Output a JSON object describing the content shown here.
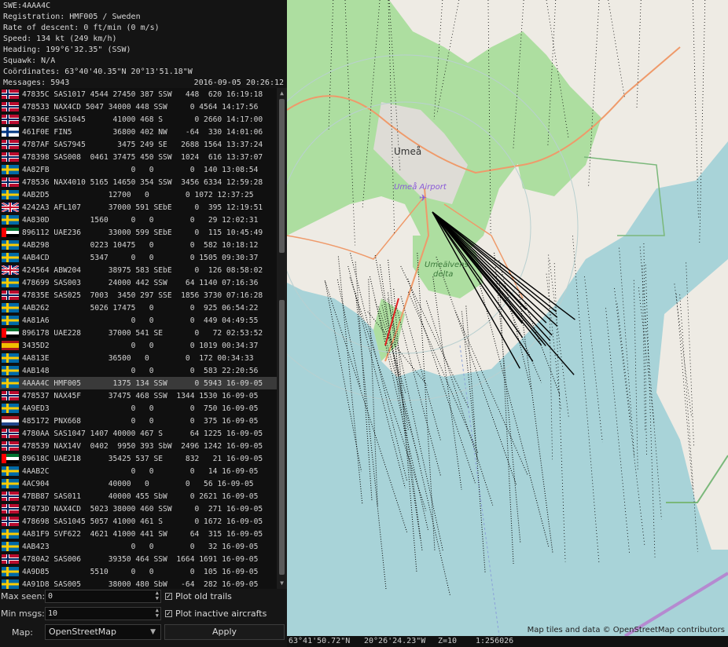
{
  "info": {
    "title": "SWE:4AAA4C",
    "registration": "Registration: HMF005 / Sweden",
    "descent": "Rate of descent: 0 ft/min (0 m/s)",
    "speed": "Speed: 134 kt (249 km/h)",
    "heading": "Heading: 199°6'32.35\" (SSW)",
    "squawk": "Squawk: N/A",
    "coordinates": "Coördinates: 63°40'40.35\"N 20°13'51.18\"W",
    "messages": "Messages: 5943",
    "timestamp": "2016-09-05 20:26:12"
  },
  "aircraft": [
    {
      "flag": "no",
      "text": "47835C SAS1017 4544 27450 387 SSW   448  620 16:19:18"
    },
    {
      "flag": "no",
      "text": "478533 NAX4CD 5047 34000 448 SSW     0 4564 14:17:56"
    },
    {
      "flag": "no",
      "text": "47836E SAS1045      41000 468 S       0 2660 14:17:00"
    },
    {
      "flag": "fi",
      "text": "461F0E FIN5         36800 402 NW    -64  330 14:01:06"
    },
    {
      "flag": "no",
      "text": "4787AF SAS7945       3475 249 SE   2688 1564 13:37:24"
    },
    {
      "flag": "no",
      "text": "478398 SAS008  0461 37475 450 SSW  1024  616 13:37:07"
    },
    {
      "flag": "se",
      "text": "4A82FB                  0   0        0  140 13:08:54"
    },
    {
      "flag": "no",
      "text": "478536 NAX4010 5165 14650 354 SSW  3456 6334 12:59:28"
    },
    {
      "flag": "se",
      "text": "4AB2D5             12700   0        0 1072 12:37:25"
    },
    {
      "flag": "gb",
      "text": "4242A3 AFL107      37000 591 SEbE     0  395 12:19:51"
    },
    {
      "flag": "se",
      "text": "4A830D         1560     0   0        0   29 12:02:31"
    },
    {
      "flag": "ae",
      "text": "896112 UAE236      33000 599 SEbE     0  115 10:45:49"
    },
    {
      "flag": "se",
      "text": "4AB298         0223 10475   0        0  582 10:18:12"
    },
    {
      "flag": "se",
      "text": "4AB4CD         5347     0   0        0 1505 09:30:37"
    },
    {
      "flag": "gb",
      "text": "424564 ABW204      38975 583 SEbE     0  126 08:58:02"
    },
    {
      "flag": "se",
      "text": "478699 SAS003      24000 442 SSW    64 1140 07:16:36"
    },
    {
      "flag": "no",
      "text": "47835E SAS025  7003  3450 297 SSE  1856 3730 07:16:28"
    },
    {
      "flag": "se",
      "text": "4AB262         5026 17475   0        0  925 06:54:22"
    },
    {
      "flag": "se",
      "text": "4A81A6                  0   0        0  449 04:49:55"
    },
    {
      "flag": "ae",
      "text": "896178 UAE228      37000 541 SE       0   72 02:53:52"
    },
    {
      "flag": "es",
      "text": "3435D2                  0   0        0 1019 00:34:37"
    },
    {
      "flag": "se",
      "text": "4A813E             36500   0        0  172 00:34:33"
    },
    {
      "flag": "se",
      "text": "4AB148                  0   0        0  583 22:20:56"
    },
    {
      "flag": "se",
      "text": "4AAA4C HMF005       1375 134 SSW      0 5943 16-09-05"
    },
    {
      "flag": "no",
      "text": "478537 NAX45F      37475 468 SSW  1344 1530 16-09-05"
    },
    {
      "flag": "se",
      "text": "4A9ED3                  0   0        0  750 16-09-05"
    },
    {
      "flag": "nl",
      "text": "485172 PNX668           0   0        0  375 16-09-05"
    },
    {
      "flag": "no",
      "text": "4780AA SAS1047 1407 40000 467 S      64 1225 16-09-05"
    },
    {
      "flag": "no",
      "text": "478539 NAX14V  0402  9950 393 SbW  2496 1242 16-09-05"
    },
    {
      "flag": "ae",
      "text": "89618C UAE218      35425 537 SE     832   21 16-09-05"
    },
    {
      "flag": "se",
      "text": "4AAB2C                  0   0        0   14 16-09-05"
    },
    {
      "flag": "se",
      "text": "4AC904             40000   0        0   56 16-09-05"
    },
    {
      "flag": "no",
      "text": "47BB87 SAS011      40000 455 SbW     0 2621 16-09-05"
    },
    {
      "flag": "no",
      "text": "47873D NAX4CD  5023 38000 460 SSW     0  271 16-09-05"
    },
    {
      "flag": "no",
      "text": "478698 SAS1045 5057 41000 461 S       0 1672 16-09-05"
    },
    {
      "flag": "se",
      "text": "4A81F9 SVF622  4621 41000 441 SW     64  315 16-09-05"
    },
    {
      "flag": "se",
      "text": "4AB423                  0   0        0   32 16-09-05"
    },
    {
      "flag": "no",
      "text": "4780A2 SAS006      39350 464 SSW  1664 1691 16-09-05"
    },
    {
      "flag": "se",
      "text": "4A9D85         5510     0   0        0  105 16-09-05"
    },
    {
      "flag": "se",
      "text": "4A91D8 SAS005      38000 480 SbW   -64  282 16-09-05"
    }
  ],
  "selected_index": 23,
  "controls": {
    "max_seen_label": "Max seen:",
    "max_seen_value": "0",
    "min_msgs_label": "Min msgs:",
    "min_msgs_value": "10",
    "plot_old_trails": "Plot old trails",
    "plot_old_trails_checked": true,
    "plot_inactive": "Plot inactive aircrafts",
    "plot_inactive_checked": true,
    "map_label": "Map:",
    "map_value": "OpenStreetMap",
    "apply_label": "Apply"
  },
  "map": {
    "city_label": "Umeå",
    "airport_label": "Umeå Airport",
    "delta_label_1": "Umeälvens",
    "delta_label_2": "delta",
    "attribution": "Map tiles and data © OpenStreetMap contributors",
    "colors": {
      "water": "#a8d3d8",
      "land": "#eeebe4",
      "forest": "#addea0",
      "road": "#ef9a6a",
      "trail": "#000000",
      "airport_label": "#8a5ad8"
    }
  },
  "status": {
    "lat": "63°41'50.72\"N",
    "lon": "20°26'24.23\"W",
    "zoom": "Z=10",
    "scale": "1:256026"
  }
}
